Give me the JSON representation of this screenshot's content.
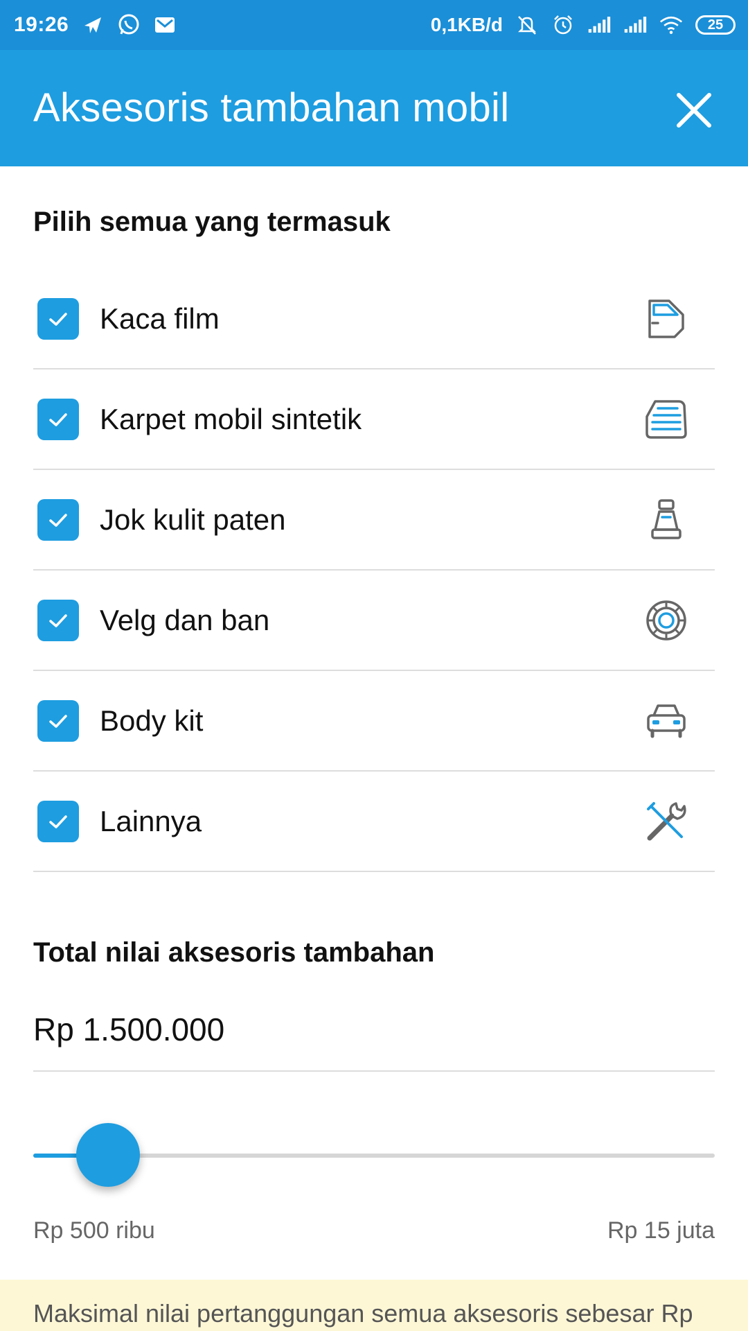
{
  "status_bar": {
    "time": "19:26",
    "net_speed": "0,1KB/d",
    "battery": "25",
    "icons": [
      "notification-bird-icon",
      "whatsapp-icon",
      "gmail-icon",
      "mute-bell-icon",
      "alarm-icon",
      "signal-icon",
      "signal-icon",
      "wifi-icon",
      "battery-icon"
    ]
  },
  "app_bar": {
    "title": "Aksesoris tambahan mobil",
    "close_icon": "close-icon",
    "color": "#1e9de0"
  },
  "options": {
    "heading": "Pilih semua yang termasuk",
    "items": [
      {
        "label": "Kaca film",
        "checked": true,
        "icon": "car-door-icon"
      },
      {
        "label": "Karpet mobil sintetik",
        "checked": true,
        "icon": "car-mat-icon"
      },
      {
        "label": "Jok kulit paten",
        "checked": true,
        "icon": "car-seat-icon"
      },
      {
        "label": "Velg dan ban",
        "checked": true,
        "icon": "wheel-icon"
      },
      {
        "label": "Body kit",
        "checked": true,
        "icon": "car-front-icon"
      },
      {
        "label": "Lainnya",
        "checked": true,
        "icon": "tools-icon"
      }
    ]
  },
  "total": {
    "heading": "Total nilai aksesoris tambahan",
    "value": "Rp 1.500.000",
    "slider_min_label": "Rp 500 ribu",
    "slider_max_label": "Rp 15 juta",
    "slider_fraction": 0.11
  },
  "note": {
    "text": "Maksimal nilai pertanggungan semua aksesoris sebesar Rp"
  }
}
